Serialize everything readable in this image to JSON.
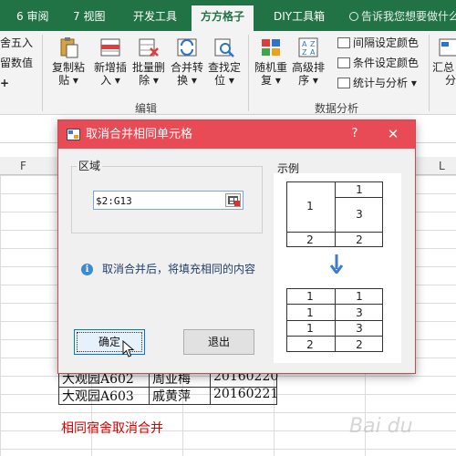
{
  "ribbon_tabs": [
    {
      "label": "6 审阅"
    },
    {
      "label": "7 视图"
    },
    {
      "label": "开发工具"
    },
    {
      "label": "方方格子"
    },
    {
      "label": "DIY工具箱"
    }
  ],
  "tell_me": "告诉我您想要做什么",
  "ribbon_left_fragments": [
    "舍五入",
    "留数值",
    "+"
  ],
  "ribbon_buttons": [
    {
      "l1": "复制粘",
      "l2": "贴 ▾"
    },
    {
      "l1": "新增插",
      "l2": "入 ▾"
    },
    {
      "l1": "批量删",
      "l2": "除 ▾"
    },
    {
      "l1": "合并转",
      "l2": "换 ▾"
    },
    {
      "l1": "查找定",
      "l2": "位 ▾"
    },
    {
      "l1": "随机重",
      "l2": "复 ▾"
    },
    {
      "l1": "高级排",
      "l2": "序 ▾"
    },
    {
      "l1": "汇总",
      "l2": "分"
    }
  ],
  "ribbon_small": [
    "间隔设定颜色",
    "条件设定颜色",
    "统计与分析 ▾"
  ],
  "group_labels": {
    "edit": "编辑",
    "analysis": "数据分析"
  },
  "col_headers": [
    "F",
    "L"
  ],
  "sheet_cells": [
    [
      "大观园A602",
      "周亚梅",
      "20160220"
    ],
    [
      "大观园A603",
      "戚黄萍",
      "20160221"
    ]
  ],
  "sheet_caption": "相同宿舍取消合并",
  "dialog": {
    "title": "取消合并相同单元格",
    "help": "?",
    "close": "✕",
    "region_label": "区域",
    "range_value": "$2:G13",
    "info_text": "取消合并后，将填充相同的内容",
    "ok_label": "确定",
    "exit_label": "退出",
    "example_label": "示例",
    "example_before": {
      "merged": "1",
      "r1": "1",
      "r2": "3",
      "b1": "2",
      "b2": "2"
    },
    "example_after": [
      [
        "1",
        "1"
      ],
      [
        "1",
        "3"
      ],
      [
        "1",
        "3"
      ],
      [
        "2",
        "2"
      ]
    ]
  },
  "watermark": "Bai du"
}
